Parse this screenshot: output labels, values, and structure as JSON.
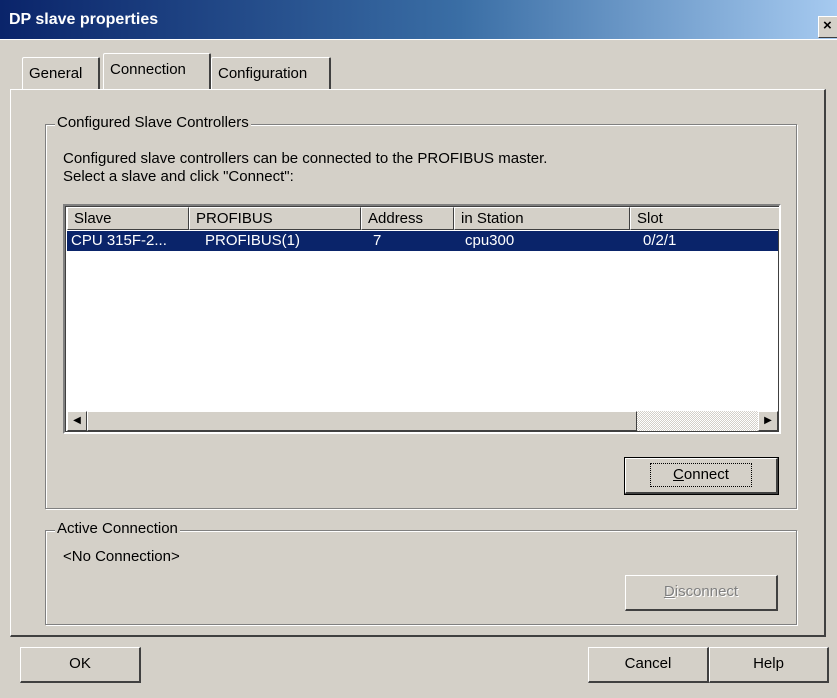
{
  "window": {
    "title": "DP slave properties",
    "close_glyph": "×"
  },
  "tabs": [
    {
      "label": "General"
    },
    {
      "label": "Connection"
    },
    {
      "label": "Configuration"
    }
  ],
  "configured": {
    "group_title": "Configured Slave Controllers",
    "description_line1": "Configured slave controllers can be connected to the PROFIBUS master.",
    "description_line2": "Select a slave and click \"Connect\":",
    "columns": [
      "Slave",
      "PROFIBUS",
      "Address",
      "in Station",
      "Slot"
    ],
    "rows": [
      {
        "slave": "CPU 315F-2...",
        "profibus": "PROFIBUS(1)",
        "address": "7",
        "station": "cpu300",
        "slot": "0/2/1",
        "selected": true
      }
    ],
    "connect_button": {
      "prefix": "",
      "accel": "C",
      "rest": "onnect"
    }
  },
  "active": {
    "group_title": "Active Connection",
    "status": "<No Connection>",
    "disconnect_button": {
      "prefix": "",
      "accel": "D",
      "rest": "isconnect"
    }
  },
  "footer": {
    "ok": "OK",
    "cancel": "Cancel",
    "help": "Help"
  },
  "icons": {
    "scroll_left": "◀",
    "scroll_right": "▶"
  },
  "colors": {
    "selection": "#0a246a",
    "titlebar": "#0a246a",
    "face": "#d4d0c8"
  }
}
